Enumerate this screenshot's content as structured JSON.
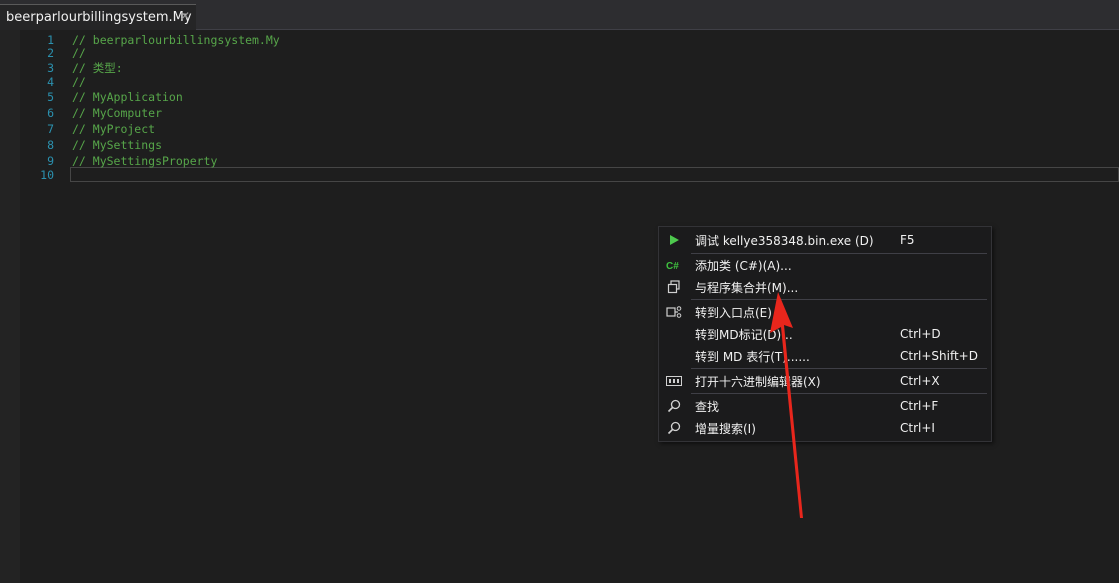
{
  "tab": {
    "title": "beerparlourbillingsystem.My",
    "close_glyph": "✕"
  },
  "code_lines": [
    {
      "num": "1",
      "text": "// beerparlourbillingsystem.My"
    },
    {
      "num": "2",
      "text": "//"
    },
    {
      "num": "3",
      "text": "// 类型:"
    },
    {
      "num": "4",
      "text": "//"
    },
    {
      "num": "5",
      "text": "// MyApplication"
    },
    {
      "num": "6",
      "text": "// MyComputer"
    },
    {
      "num": "7",
      "text": "// MyProject"
    },
    {
      "num": "8",
      "text": "// MySettings"
    },
    {
      "num": "9",
      "text": "// MySettingsProperty"
    },
    {
      "num": "10",
      "text": ""
    }
  ],
  "context_menu": {
    "items": [
      {
        "icon": "play-icon",
        "label": "调试 kellye358348.bin.exe (D)",
        "shortcut": "F5"
      },
      {
        "icon": "csharp-icon",
        "label": "添加类 (C#)(A)...",
        "shortcut": ""
      },
      {
        "icon": "merge-icon",
        "label": "与程序集合并(M)...",
        "shortcut": ""
      },
      {
        "icon": "entry-point-icon",
        "label": "转到入口点(E)",
        "shortcut": ""
      },
      {
        "icon": "",
        "label": "转到MD标记(D)...",
        "shortcut": "Ctrl+D"
      },
      {
        "icon": "",
        "label": "转到 MD 表行(T)......",
        "shortcut": "Ctrl+Shift+D"
      },
      {
        "icon": "hex-editor-icon",
        "label": "打开十六进制编辑器(X)",
        "shortcut": "Ctrl+X"
      },
      {
        "icon": "search-icon",
        "label": "查找",
        "shortcut": "Ctrl+F"
      },
      {
        "icon": "search-icon",
        "label": "增量搜索(I)",
        "shortcut": "Ctrl+I"
      }
    ]
  },
  "colors": {
    "comment": "#57a64a",
    "line_number": "#2b91af",
    "play_green": "#4ec94e",
    "csharp_green": "#3fc23f",
    "annotation_arrow": "#e8261c"
  }
}
